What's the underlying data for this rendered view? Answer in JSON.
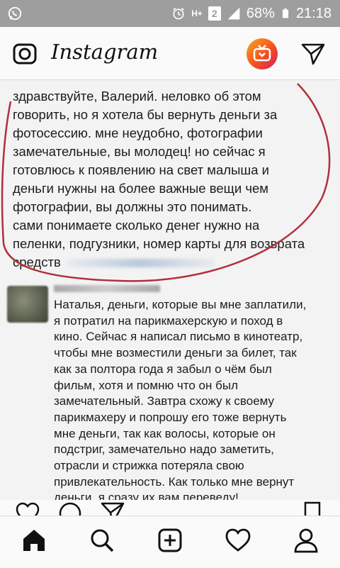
{
  "status_bar": {
    "network_label": "H+",
    "sim_label": "2",
    "battery": "68%",
    "time": "21:18"
  },
  "app": {
    "title": "Instagram"
  },
  "post": {
    "message_1_lines": [
      "здравствуйте, Валерий. неловко об этом",
      "говорить, но я хотела бы вернуть деньги за",
      "фотосессию. мне неудобно, фотографии",
      "замечательные, вы молодец! но сейчас я",
      "готовлюсь к появлению на свет малыша и",
      "деньги нужны на более важные вещи чем",
      "фотографии, вы должны это понимать.",
      "сами понимаете сколько денег нужно на",
      "пеленки, подгузники, номер карты для возврата",
      "средств"
    ],
    "message_2_lines": [
      "Наталья, деньги, которые вы мне заплатили,",
      "я потратил на парикмахерскую и поход в",
      "кино. Сейчас я написал письмо в кинотеатр,",
      "чтобы мне возместили деньги за билет, так",
      "как за полтора года я забыл о чём был",
      "фильм, хотя и помню что он был",
      "замечательный. Завтра схожу к своему",
      "парикмахеру и попрошу его тоже вернуть",
      "мне деньги, так как волосы, которые он",
      "подстриг, замечательно надо заметить,",
      "отрасли и стрижка потеряла свою",
      "привлекательность. Как только мне вернут",
      "деньги, я сразу их вам переведу!"
    ]
  },
  "icons": {
    "status_left": "whatsapp-icon",
    "alarm": "alarm-icon",
    "signal": "signal-icon",
    "battery": "battery-icon",
    "camera": "camera-icon",
    "igtv": "igtv-icon",
    "direct": "paper-plane-icon",
    "like": "heart-icon",
    "comment": "comment-icon",
    "share": "share-icon",
    "save": "bookmark-icon",
    "nav_home": "home-icon",
    "nav_search": "search-icon",
    "nav_add": "add-post-icon",
    "nav_activity": "heart-icon",
    "nav_profile": "profile-icon"
  },
  "colors": {
    "status_bar": "#9e9e9e",
    "annotation_red": "#b0303a"
  }
}
